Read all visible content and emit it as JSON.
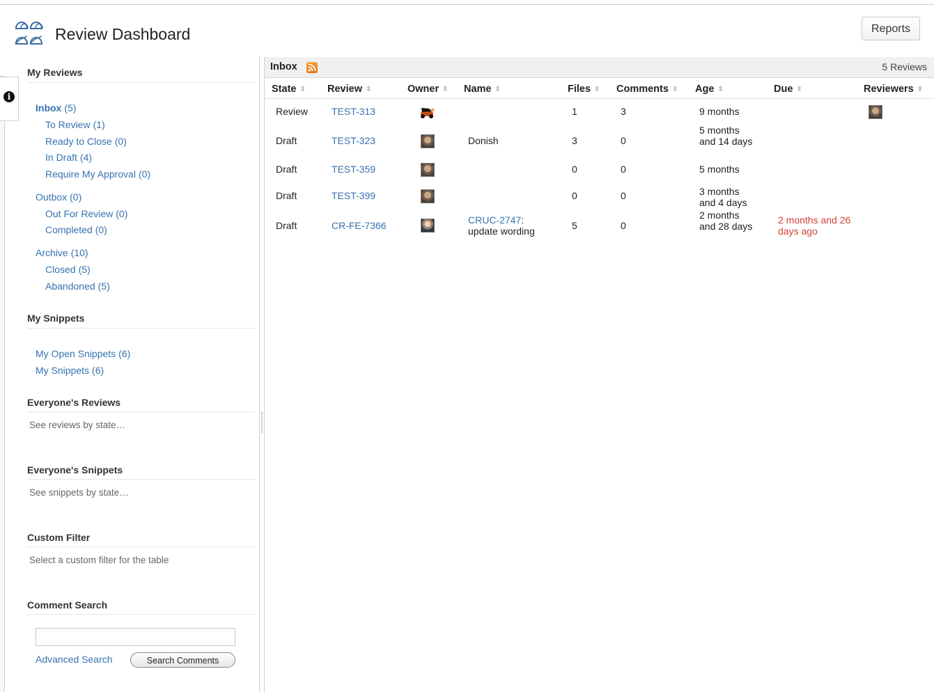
{
  "header": {
    "title": "Review Dashboard",
    "reports_label": "Reports"
  },
  "sidebar": {
    "my_reviews": {
      "title": "My Reviews",
      "groups": [
        {
          "label": "Inbox",
          "count": "(5)",
          "children": [
            {
              "label": "To Review",
              "count": "(1)"
            },
            {
              "label": "Ready to Close",
              "count": "(0)"
            },
            {
              "label": "In Draft",
              "count": "(4)"
            },
            {
              "label": "Require My Approval",
              "count": "(0)"
            }
          ]
        },
        {
          "label": "Outbox",
          "count": "(0)",
          "children": [
            {
              "label": "Out For Review",
              "count": "(0)"
            },
            {
              "label": "Completed",
              "count": "(0)"
            }
          ]
        },
        {
          "label": "Archive",
          "count": "(10)",
          "children": [
            {
              "label": "Closed",
              "count": "(5)"
            },
            {
              "label": "Abandoned",
              "count": "(5)"
            }
          ]
        }
      ]
    },
    "my_snippets": {
      "title": "My Snippets",
      "items": [
        {
          "label": "My Open Snippets",
          "count": "(6)"
        },
        {
          "label": "My Snippets",
          "count": "(6)"
        }
      ]
    },
    "everyone_reviews": {
      "title": "Everyone's Reviews",
      "hint": "See reviews by state…"
    },
    "everyone_snippets": {
      "title": "Everyone's Snippets",
      "hint": "See snippets by state…"
    },
    "custom_filter": {
      "title": "Custom Filter",
      "hint": "Select a custom filter for the table"
    },
    "comment_search": {
      "title": "Comment Search",
      "input_value": "",
      "advanced_label": "Advanced Search",
      "button_label": "Search Comments"
    }
  },
  "main": {
    "inbox_title": "Inbox",
    "review_count": "5 Reviews",
    "columns": [
      "State",
      "Review",
      "Owner",
      "Name",
      "Files",
      "Comments",
      "Age",
      "Due",
      "Reviewers"
    ],
    "rows": [
      {
        "state": "Review",
        "review": "TEST-313",
        "owner_icon": "dog-avatar-icon",
        "name_link": "",
        "name_text": "",
        "files": "1",
        "comments": "3",
        "age": "9 months",
        "due": "",
        "has_reviewer": true
      },
      {
        "state": "Draft",
        "review": "TEST-323",
        "owner_icon": "user-avatar-icon",
        "name_link": "",
        "name_text": "Donish",
        "files": "3",
        "comments": "0",
        "age": "5 months and 14 days",
        "due": "",
        "has_reviewer": false
      },
      {
        "state": "Draft",
        "review": "TEST-359",
        "owner_icon": "user-avatar-icon",
        "name_link": "",
        "name_text": "",
        "files": "0",
        "comments": "0",
        "age": "5 months",
        "due": "",
        "has_reviewer": false
      },
      {
        "state": "Draft",
        "review": "TEST-399",
        "owner_icon": "user-avatar-icon",
        "name_link": "",
        "name_text": "",
        "files": "0",
        "comments": "0",
        "age": "3 months and 4 days",
        "due": "",
        "has_reviewer": false
      },
      {
        "state": "Draft",
        "review": "CR-FE-7366",
        "owner_icon": "user-avatar-icon",
        "name_link": "CRUC-2747",
        "name_text": ": update wording",
        "files": "5",
        "comments": "0",
        "age": "2 months and 28 days",
        "due": "2 months and 26 days ago",
        "has_reviewer": false
      }
    ]
  },
  "colors": {
    "link": "#3572b0",
    "overdue": "#d04437",
    "rss": "#e1731a"
  }
}
